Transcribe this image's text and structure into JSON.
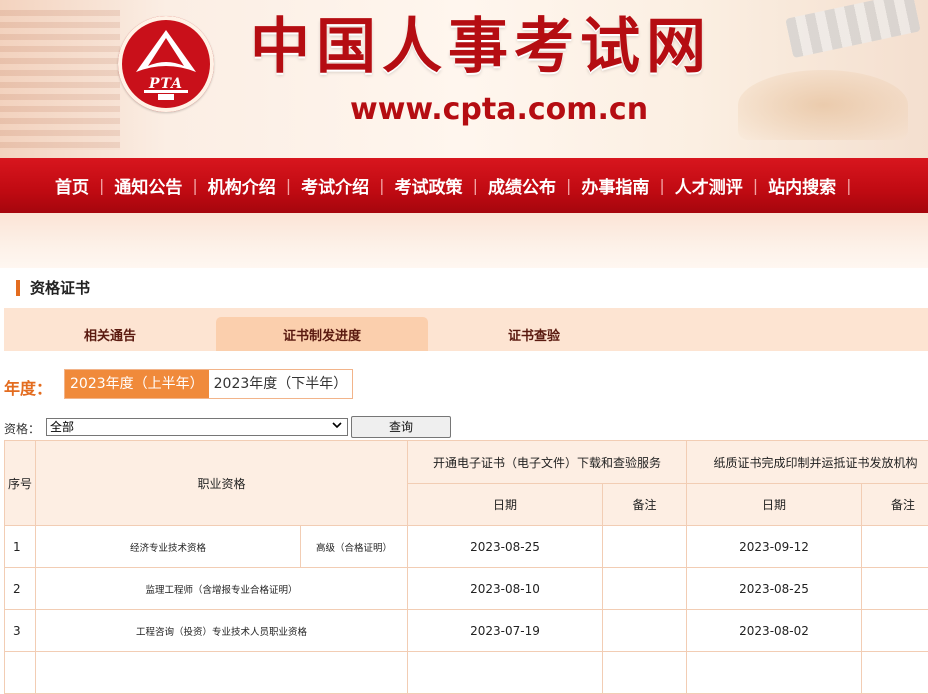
{
  "header": {
    "logo_text": "PTA",
    "site_title": "中国人事考试网",
    "site_url": "www.cpta.com.cn"
  },
  "nav": {
    "items": [
      "首页",
      "通知公告",
      "机构介绍",
      "考试介绍",
      "考试政策",
      "成绩公布",
      "办事指南",
      "人才测评",
      "站内搜索"
    ]
  },
  "section": {
    "title": "资格证书"
  },
  "tabs": [
    {
      "label": "相关通告"
    },
    {
      "label": "证书制发进度"
    },
    {
      "label": "证书查验"
    }
  ],
  "year": {
    "label": "年度：",
    "options": [
      "2023年度（上半年）",
      "2023年度（下半年）"
    ],
    "selected": "2023年度（上半年）"
  },
  "filter": {
    "label": "资格：",
    "select_value": "全部",
    "query_button": "查询"
  },
  "table": {
    "headers": {
      "no": "序号",
      "qualification": "职业资格",
      "electronic_group": "开通电子证书（电子文件）下载和查验服务",
      "paper_group": "纸质证书完成印制并运抵证书发放机构",
      "date": "日期",
      "remark": "备注"
    },
    "rows": [
      {
        "no": "1",
        "name": "经济专业技术资格",
        "level": "高级（合格证明）",
        "e_date": "2023-08-25",
        "e_remark": "",
        "p_date": "2023-09-12",
        "p_remark": ""
      },
      {
        "no": "2",
        "name": "监理工程师（含增报专业合格证明）",
        "level": "",
        "e_date": "2023-08-10",
        "e_remark": "",
        "p_date": "2023-08-25",
        "p_remark": ""
      },
      {
        "no": "3",
        "name": "工程咨询（投资）专业技术人员职业资格",
        "level": "",
        "e_date": "2023-07-19",
        "e_remark": "",
        "p_date": "2023-08-02",
        "p_remark": ""
      }
    ]
  },
  "colors": {
    "brand_red": "#c00a12",
    "accent_orange": "#e36c1f",
    "table_border": "#f2cdb4"
  }
}
